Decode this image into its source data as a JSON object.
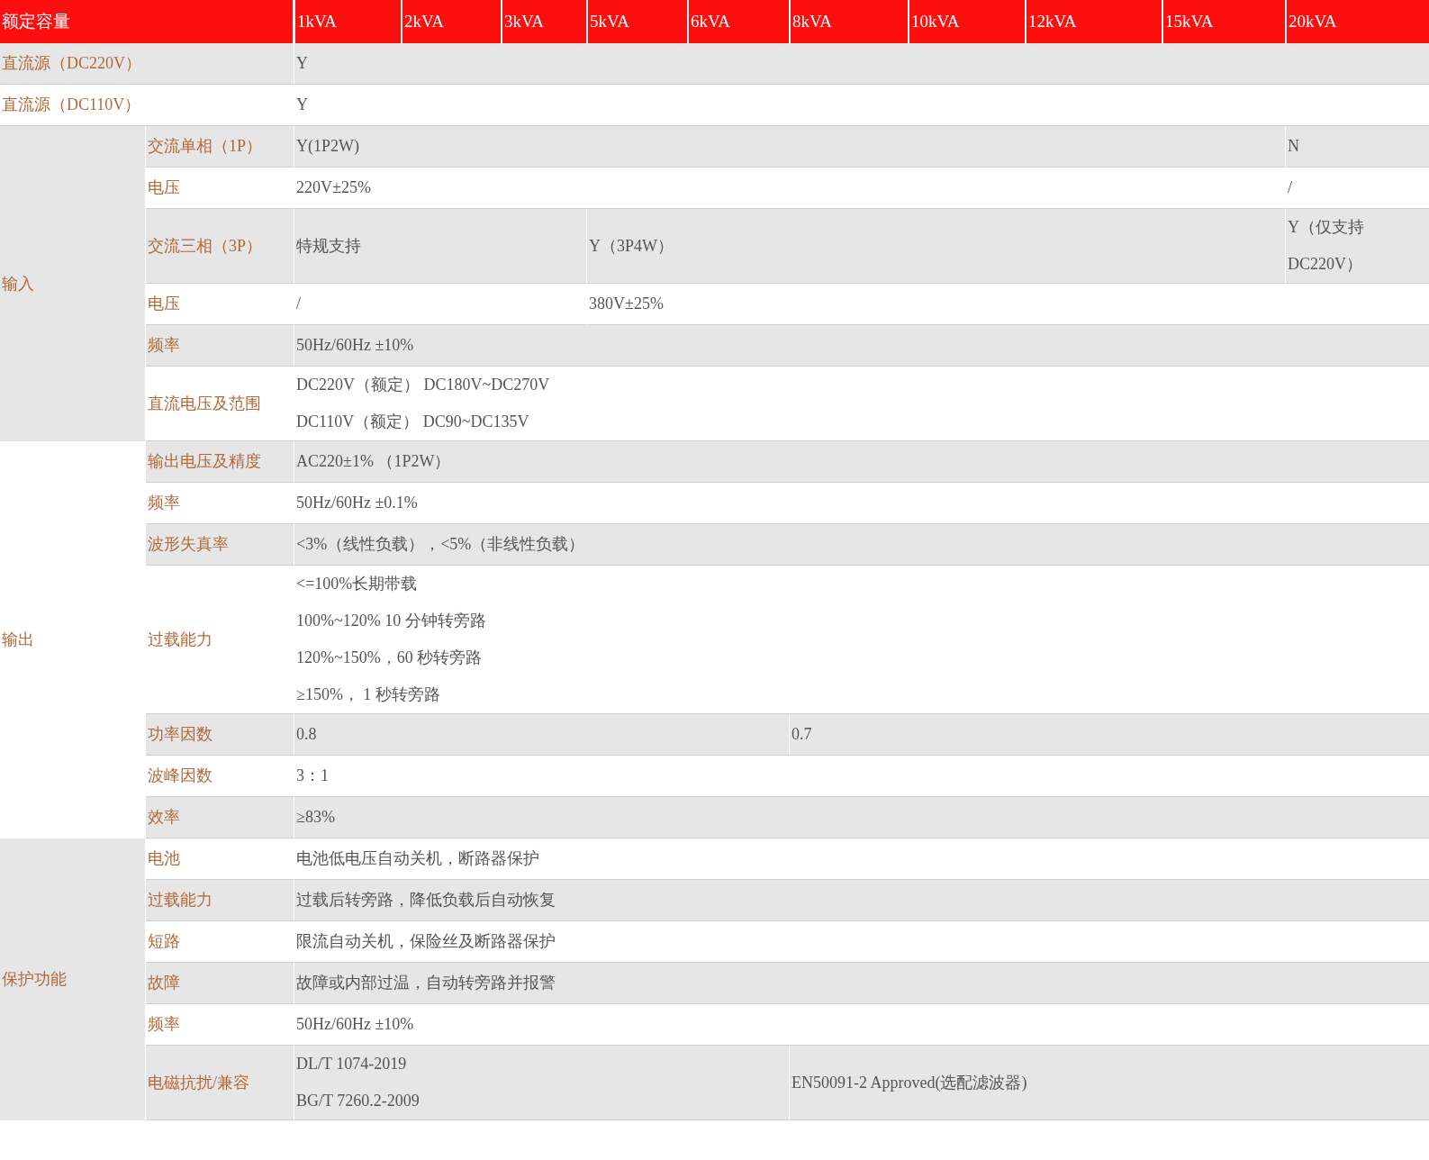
{
  "header": {
    "label": "额定容量",
    "capacities": [
      "1kVA",
      "2kVA",
      "3kVA",
      "5kVA",
      "6kVA",
      "8kVA",
      "10kVA",
      "12kVA",
      "15kVA",
      "20kVA"
    ]
  },
  "sections": [
    {
      "kind": "single",
      "label": "直流源（DC220V）",
      "cells": [
        {
          "lines": [
            "Y"
          ]
        }
      ]
    },
    {
      "kind": "single",
      "label": "直流源（DC110V）",
      "cells": [
        {
          "lines": [
            "Y"
          ]
        }
      ]
    },
    {
      "kind": "group",
      "label": "输入",
      "shaded": true,
      "rows": [
        {
          "label": "交流单相（1P）",
          "cells": [
            {
              "lines": [
                "Y(1P2W)"
              ]
            },
            {
              "lines": [
                "N"
              ]
            }
          ]
        },
        {
          "label": "电压",
          "cells": [
            {
              "lines": [
                "220V±25%"
              ]
            },
            {
              "lines": [
                "/"
              ]
            }
          ]
        },
        {
          "label": "交流三相（3P）",
          "cells": [
            {
              "lines": [
                "特规支持"
              ]
            },
            {
              "lines": [
                "Y（3P4W）"
              ]
            },
            {
              "lines": [
                "Y（仅支持",
                "DC220V）"
              ]
            }
          ]
        },
        {
          "label": "电压",
          "cells": [
            {
              "lines": [
                "/"
              ]
            },
            {
              "lines": [
                "380V±25%"
              ]
            }
          ]
        },
        {
          "label": "频率",
          "cells": [
            {
              "lines": [
                "50Hz/60Hz ±10%"
              ]
            }
          ]
        },
        {
          "label": "直流电压及范围",
          "cells": [
            {
              "lines": [
                "DC220V（额定） DC180V~DC270V",
                "DC110V（额定） DC90~DC135V"
              ]
            }
          ]
        }
      ]
    },
    {
      "kind": "group",
      "label": "输出",
      "shaded": false,
      "rows": [
        {
          "label": "输出电压及精度",
          "cells": [
            {
              "lines": [
                "AC220±1% （1P2W）"
              ]
            }
          ]
        },
        {
          "label": "频率",
          "cells": [
            {
              "lines": [
                "50Hz/60Hz ±0.1%"
              ]
            }
          ]
        },
        {
          "label": "波形失真率",
          "cells": [
            {
              "lines": [
                "<3%（线性负载），<5%（非线性负载）"
              ]
            }
          ]
        },
        {
          "label": "过载能力",
          "cells": [
            {
              "lines": [
                "<=100%长期带载",
                "100%~120% 10 分钟转旁路",
                "120%~150%，60 秒转旁路",
                "≥150%， 1 秒转旁路"
              ]
            }
          ]
        },
        {
          "label": "功率因数",
          "cells": [
            {
              "lines": [
                "0.8"
              ]
            },
            {
              "lines": [
                "0.7"
              ]
            }
          ]
        },
        {
          "label": "波峰因数",
          "cells": [
            {
              "lines": [
                "3：1"
              ]
            }
          ]
        },
        {
          "label": "效率",
          "cells": [
            {
              "lines": [
                "≥83%"
              ]
            }
          ]
        }
      ]
    },
    {
      "kind": "group",
      "label": "保护功能",
      "shaded": true,
      "rows": [
        {
          "label": "电池",
          "cells": [
            {
              "lines": [
                "电池低电压自动关机，断路器保护"
              ]
            }
          ]
        },
        {
          "label": "过载能力",
          "cells": [
            {
              "lines": [
                "过载后转旁路，降低负载后自动恢复"
              ]
            }
          ]
        },
        {
          "label": "短路",
          "cells": [
            {
              "lines": [
                "限流自动关机，保险丝及断路器保护"
              ]
            }
          ]
        },
        {
          "label": "故障",
          "cells": [
            {
              "lines": [
                "故障或内部过温，自动转旁路并报警"
              ]
            }
          ]
        },
        {
          "label": "频率",
          "cells": [
            {
              "lines": [
                "50Hz/60Hz ±10%"
              ]
            }
          ]
        },
        {
          "label": "电磁抗扰/兼容",
          "cells": [
            {
              "lines": [
                "DL/T 1074-2019",
                "BG/T 7260.2-2009"
              ]
            },
            {
              "lines": [
                "EN50091-2 Approved(选配滤波器)"
              ]
            }
          ]
        }
      ]
    }
  ]
}
